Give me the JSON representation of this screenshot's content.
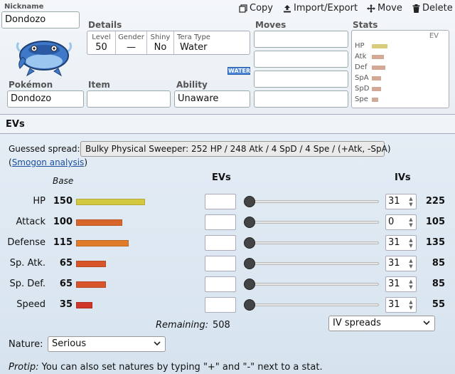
{
  "toolbar": {
    "copy_label": "Copy",
    "import_export_label": "Import/Export",
    "move_label": "Move",
    "delete_label": "Delete"
  },
  "set": {
    "nickname_label": "Nickname",
    "nickname_value": "Dondozo",
    "details_label": "Details",
    "details": {
      "level_label": "Level",
      "level_value": "50",
      "gender_label": "Gender",
      "gender_value": "—",
      "shiny_label": "Shiny",
      "shiny_value": "No",
      "tera_label": "Tera Type",
      "tera_value": "Water"
    },
    "type_badge": "WATER",
    "pokemon_label": "Pokémon",
    "pokemon_value": "Dondozo",
    "item_label": "Item",
    "item_value": "",
    "ability_label": "Ability",
    "ability_value": "Unaware",
    "moves_label": "Moves",
    "moves": [
      "",
      "",
      "",
      ""
    ],
    "stats_label": "Stats",
    "stats_ev_label": "EV",
    "stats_mini": [
      {
        "label": "HP",
        "fill": 0.58
      },
      {
        "label": "Atk",
        "fill": 0.46
      },
      {
        "label": "Def",
        "fill": 0.5
      },
      {
        "label": "SpA",
        "fill": 0.34
      },
      {
        "label": "SpD",
        "fill": 0.34
      },
      {
        "label": "Spe",
        "fill": 0.24
      }
    ]
  },
  "ev_panel": {
    "title": "EVs",
    "guessed_spread_label": "Guessed spread:",
    "guessed_spread_value": "Bulky Physical Sweeper: 252 HP / 248 Atk / 4 SpD / 4 Spe / (+Atk, -SpA)",
    "smogon_open": "(",
    "smogon_link": "Smogon analysis",
    "smogon_close": ")",
    "base_header": "Base",
    "evs_header": "EVs",
    "ivs_header": "IVs",
    "rows": [
      {
        "label": "HP",
        "base": "150",
        "ev": "",
        "ev_level": 0,
        "iv": "31",
        "total": "225",
        "color": "#d4c840"
      },
      {
        "label": "Attack",
        "base": "100",
        "ev": "",
        "ev_level": 0,
        "iv": "0",
        "total": "105",
        "color": "#d8662a"
      },
      {
        "label": "Defense",
        "base": "115",
        "ev": "",
        "ev_level": 0,
        "iv": "31",
        "total": "135",
        "color": "#de7c2a"
      },
      {
        "label": "Sp. Atk.",
        "base": "65",
        "ev": "",
        "ev_level": 0,
        "iv": "31",
        "total": "85",
        "color": "#d8552a"
      },
      {
        "label": "Sp. Def.",
        "base": "65",
        "ev": "",
        "ev_level": 0,
        "iv": "31",
        "total": "85",
        "color": "#d8552a"
      },
      {
        "label": "Speed",
        "base": "35",
        "ev": "",
        "ev_level": 0,
        "iv": "31",
        "total": "55",
        "color": "#d0362a"
      }
    ],
    "remaining_label": "Remaining:",
    "remaining_value": "508",
    "iv_spreads_select": "IV spreads",
    "nature_label": "Nature:",
    "nature_value": "Serious",
    "protip_label": "Protip:",
    "protip_text": " You can also set natures by typing \"+\" and \"-\" next to a stat."
  },
  "colors": {
    "water_badge": "#4a86d8",
    "link": "#1a4fa0"
  },
  "icons": [
    "copy-icon",
    "upload-icon",
    "move-icon",
    "trash-icon",
    "dondozo-sprite-icon",
    "chevron-down-icon"
  ]
}
